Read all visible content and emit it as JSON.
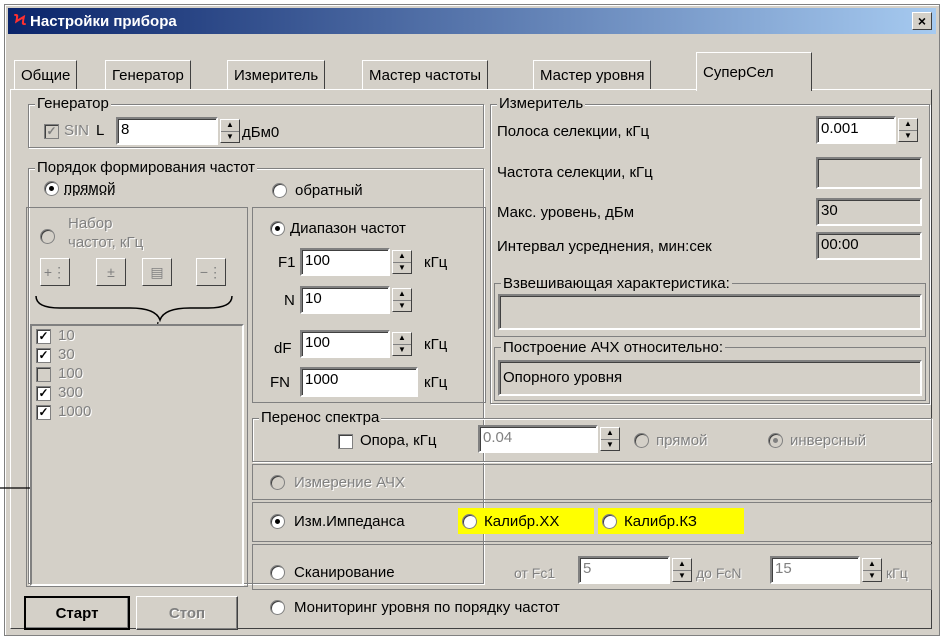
{
  "window": {
    "title": "Настройки прибора",
    "close": "×",
    "logo": "Ϟ"
  },
  "tabs": [
    "Общие",
    "Генератор",
    "Измеритель",
    "Мастер частоты",
    "Мастер уровня",
    "СуперСел"
  ],
  "generator": {
    "caption": "Генератор",
    "sin_label": "SIN",
    "l_label": "L",
    "l_value": "8",
    "unit": "дБм0"
  },
  "order": {
    "caption": "Порядок формирования частот",
    "direct": "прямой",
    "reverse": "обратный"
  },
  "freqset": {
    "label_line1": "Набор",
    "label_line2": "частот, кГц",
    "items": [
      {
        "value": "10",
        "checked": true
      },
      {
        "value": "30",
        "checked": true
      },
      {
        "value": "100",
        "checked": false
      },
      {
        "value": "300",
        "checked": true
      },
      {
        "value": "1000",
        "checked": true
      }
    ]
  },
  "range": {
    "label": "Диапазон частот",
    "f1_label": "F1",
    "f1_value": "100",
    "n_label": "N",
    "n_value": "10",
    "df_label": "dF",
    "df_value": "100",
    "fn_label": "FN",
    "fn_value": "1000",
    "unit": "кГц"
  },
  "meter": {
    "caption": "Измеритель",
    "band_label": "Полоса селекции, кГц",
    "band_value": "0.001",
    "freq_label": "Частота селекции, кГц",
    "freq_value": "",
    "max_label": "Макс. уровень, дБм",
    "max_value": "30",
    "interval_label": "Интервал усреднения, мин:сек",
    "interval_value": "00:00",
    "weight_caption": "Взвешивающая характеристика:",
    "weight_value": "",
    "afc_caption": "Построение АЧХ относительно:",
    "afc_value": "Опорного уровня"
  },
  "spectrum": {
    "caption": "Перенос спектра",
    "ref_label": "Опора, кГц",
    "ref_value": "0.04",
    "direct": "прямой",
    "inverse": "инверсный"
  },
  "modes": {
    "afc": "Измерение АЧХ",
    "impedance": "Изм.Импеданса",
    "cal_xx": "Калибр.XX",
    "cal_kz": "Калибр.КЗ",
    "scan": "Сканирование",
    "from_label": "от Fc1",
    "from_value": "5",
    "to_label": "до FcN",
    "to_value": "15",
    "unit": "кГц",
    "monitor": "Мониторинг  уровня по порядку частот"
  },
  "buttons": {
    "start": "Старт",
    "stop": "Стоп"
  },
  "colors": {
    "title_start": "#0a246a",
    "title_end": "#a6caf0",
    "highlight": "#ffff00",
    "face": "#d4d0c8"
  }
}
